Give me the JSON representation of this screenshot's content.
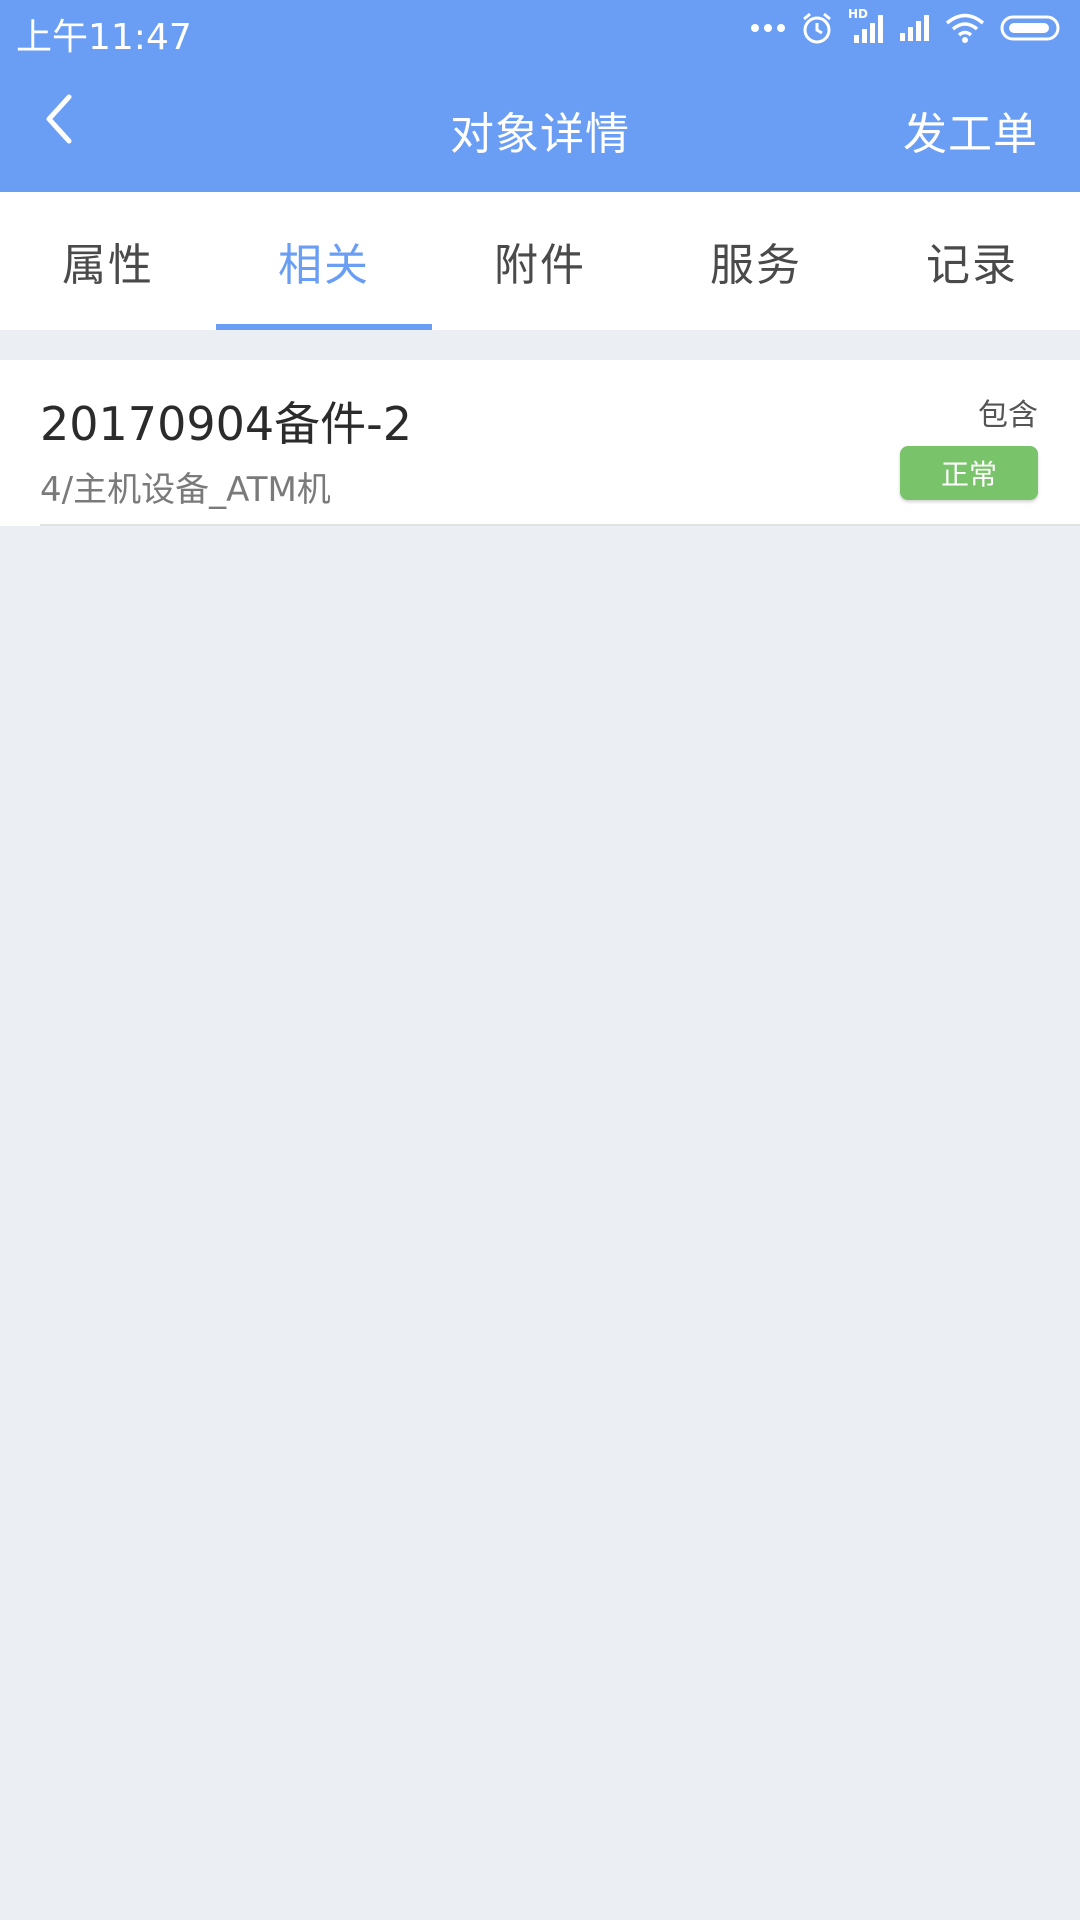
{
  "status_bar": {
    "time": "上午11:47",
    "hd_label": "HD",
    "icons": [
      "more-dots-icon",
      "alarm-icon",
      "hd-signal-icon",
      "signal-icon",
      "wifi-icon",
      "battery-icon"
    ]
  },
  "app_bar": {
    "title": "对象详情",
    "action_label": "发工单",
    "back_icon": "chevron-left-icon"
  },
  "tabs": [
    {
      "label": "属性",
      "active": false
    },
    {
      "label": "相关",
      "active": true
    },
    {
      "label": "附件",
      "active": false
    },
    {
      "label": "服务",
      "active": false
    },
    {
      "label": "记录",
      "active": false
    }
  ],
  "related_items": [
    {
      "title": "20170904备件-2",
      "subtitle": "4/主机设备_ATM机",
      "relation": "包含",
      "status": "正常"
    }
  ],
  "colors": {
    "primary": "#6a9ef5",
    "status_normal": "#79c36b",
    "background": "#ebeef3"
  }
}
